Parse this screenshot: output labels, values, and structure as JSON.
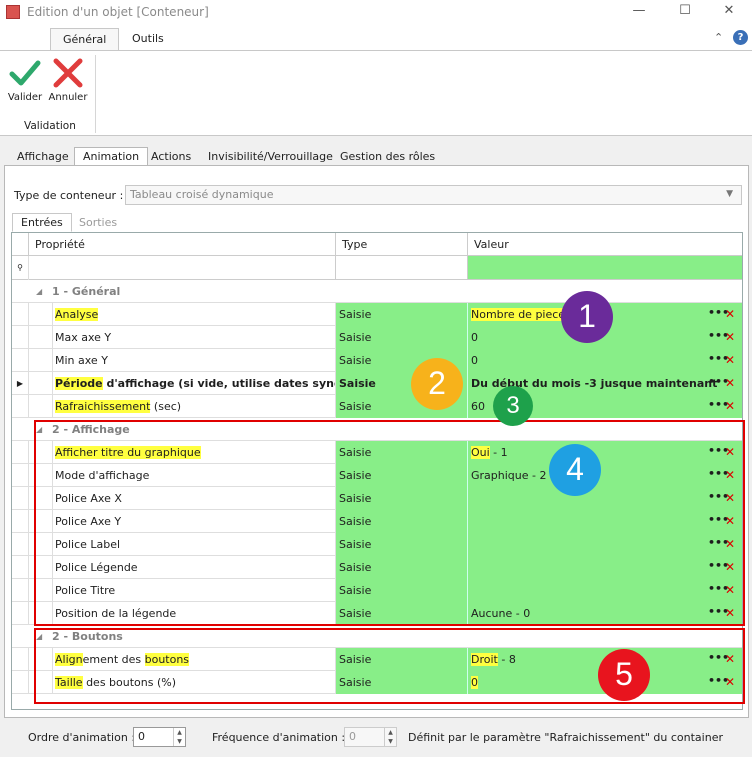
{
  "window": {
    "title": "Edition d'un objet [Conteneur]",
    "minimize": "—",
    "maximize": "☐",
    "close": "✕"
  },
  "ribbon": {
    "tabs": [
      "Général",
      "Outils"
    ],
    "buttons": [
      {
        "label": "Valider",
        "icon": "checkmark-icon",
        "color": "#2ea86c"
      },
      {
        "label": "Annuler",
        "icon": "cross-icon",
        "color": "#e03c3c"
      }
    ],
    "group_label": "Validation",
    "collapse": "⌃",
    "help": "?"
  },
  "tabs": [
    "Affichage",
    "Animation",
    "Actions",
    "Invisibilité/Verrouillage",
    "Gestion des rôles"
  ],
  "active_tab": "Animation",
  "container": {
    "label": "Type de conteneur :",
    "value": "Tableau croisé dynamique"
  },
  "subtabs": [
    "Entrées",
    "Sorties"
  ],
  "grid": {
    "columns": [
      "Propriété",
      "Type",
      "Valeur"
    ],
    "groups": [
      {
        "title": "1 - Général",
        "rows": [
          {
            "prop_hl": "Analyse",
            "prop_rest": "",
            "type": "Saisie",
            "value_hl": "",
            "value_rest": "Nombre de pieces",
            "value_all_hl": true
          },
          {
            "prop_hl": "",
            "prop_rest": "Max axe Y",
            "type": "Saisie",
            "value_hl": "",
            "value_rest": "0"
          },
          {
            "prop_hl": "",
            "prop_rest": "Min axe Y",
            "type": "Saisie",
            "value_hl": "",
            "value_rest": "0"
          },
          {
            "prop_hl": "Période",
            "prop_rest": " d'affichage (si vide, utilise dates synop...",
            "type": "Saisie",
            "value_hl": "",
            "value_rest": "Du début du mois -3 jusque maintenant",
            "bold": true,
            "selected": true
          },
          {
            "prop_hl": "Rafraichissement",
            "prop_rest": " (sec)",
            "type": "Saisie",
            "value_hl": "",
            "value_rest": "60"
          }
        ]
      },
      {
        "title": "2 - Affichage",
        "rows": [
          {
            "prop_hl": "Afficher titre du graphique",
            "prop_rest": "",
            "type": "Saisie",
            "value_hl": "Oui",
            "value_rest": " - 1"
          },
          {
            "prop_hl": "",
            "prop_rest": "Mode d'affichage",
            "type": "Saisie",
            "value_hl": "",
            "value_rest": "Graphique - 2"
          },
          {
            "prop_hl": "",
            "prop_rest": "Police Axe X",
            "type": "Saisie",
            "value_hl": "",
            "value_rest": ""
          },
          {
            "prop_hl": "",
            "prop_rest": "Police Axe Y",
            "type": "Saisie",
            "value_hl": "",
            "value_rest": ""
          },
          {
            "prop_hl": "",
            "prop_rest": "Police Label",
            "type": "Saisie",
            "value_hl": "",
            "value_rest": ""
          },
          {
            "prop_hl": "",
            "prop_rest": "Police Légende",
            "type": "Saisie",
            "value_hl": "",
            "value_rest": ""
          },
          {
            "prop_hl": "",
            "prop_rest": "Police Titre",
            "type": "Saisie",
            "value_hl": "",
            "value_rest": ""
          },
          {
            "prop_hl": "",
            "prop_rest": "Position de la légende",
            "type": "Saisie",
            "value_hl": "",
            "value_rest": "Aucune - 0"
          }
        ]
      },
      {
        "title": "2 - Boutons",
        "rows": [
          {
            "prop_hl": "Align",
            "prop_rest": "ement des ",
            "prop_hl2": "boutons",
            "type": "Saisie",
            "value_hl": "Droit",
            "value_rest": " - 8"
          },
          {
            "prop_hl": "Taille",
            "prop_rest": " des boutons (%)",
            "type": "Saisie",
            "value_hl": "0",
            "value_rest": ""
          }
        ]
      }
    ],
    "dots": "•••",
    "remove": "✕"
  },
  "annotations": [
    {
      "number": "1",
      "color": "#6a2b9a"
    },
    {
      "number": "2",
      "color": "#f7b21b"
    },
    {
      "number": "3",
      "color": "#1ea14b"
    },
    {
      "number": "4",
      "color": "#1fa0e2"
    },
    {
      "number": "5",
      "color": "#e8141e"
    }
  ],
  "bottom": {
    "order_label": "Ordre d'animation :",
    "order_value": "0",
    "freq_label": "Fréquence d'animation :",
    "freq_value": "0",
    "note": "Définit par le paramètre \"Rafraichissement\" du container"
  }
}
